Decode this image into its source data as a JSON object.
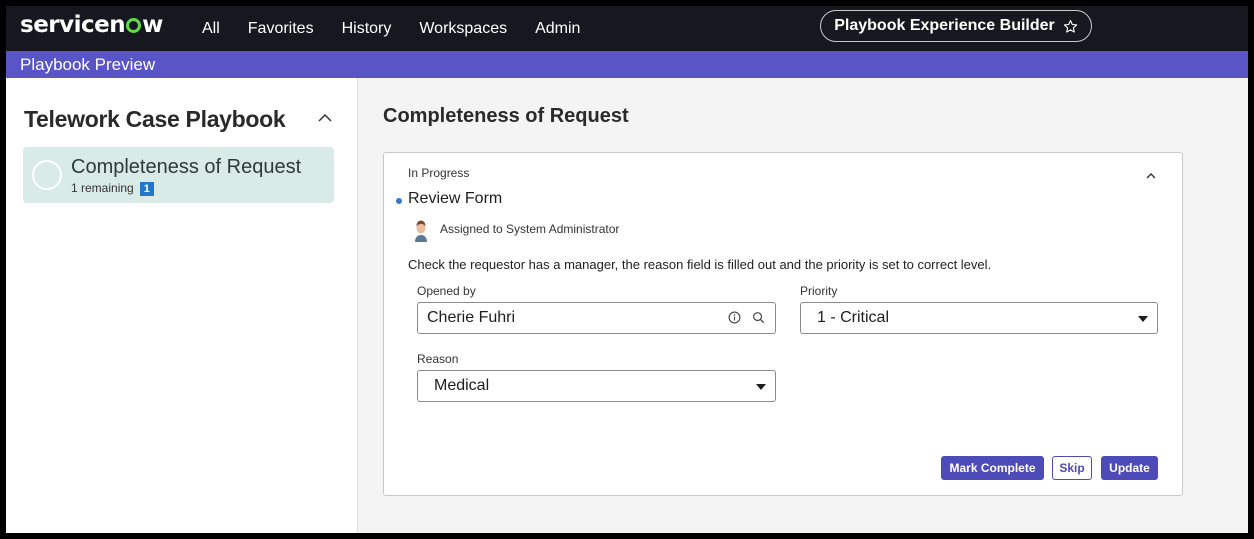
{
  "brand": {
    "name_part1": "servicen",
    "name_part2": "w",
    "logo_accent": "#62d84e"
  },
  "nav": {
    "links": [
      "All",
      "Favorites",
      "History",
      "Workspaces",
      "Admin"
    ],
    "pill_label": "Playbook Experience Builder",
    "pill_icon": "star-outline-icon"
  },
  "preview_bar": {
    "label": "Playbook Preview",
    "color": "#5a55c7"
  },
  "sidebar": {
    "playbook_title": "Telework Case Playbook",
    "activity": {
      "title": "Completeness of Request",
      "remaining_text": "1 remaining",
      "badge_count": "1",
      "highlight_color": "#d8ebe6"
    }
  },
  "main": {
    "title": "Completeness of Request",
    "card": {
      "status": "In Progress",
      "task_title": "Review Form",
      "assigned_text": "Assigned to System Administrator",
      "instructions": "Check the requestor has a manager, the reason field is filled out and the priority is set to correct level.",
      "fields": {
        "opened_by": {
          "label": "Opened by",
          "value": "Cherie Fuhri"
        },
        "priority": {
          "label": "Priority",
          "value": "1 - Critical"
        },
        "reason": {
          "label": "Reason",
          "value": "Medical"
        }
      },
      "buttons": {
        "mark_complete": "Mark Complete",
        "skip": "Skip",
        "update": "Update"
      },
      "button_color": "#4e4ab7"
    }
  }
}
